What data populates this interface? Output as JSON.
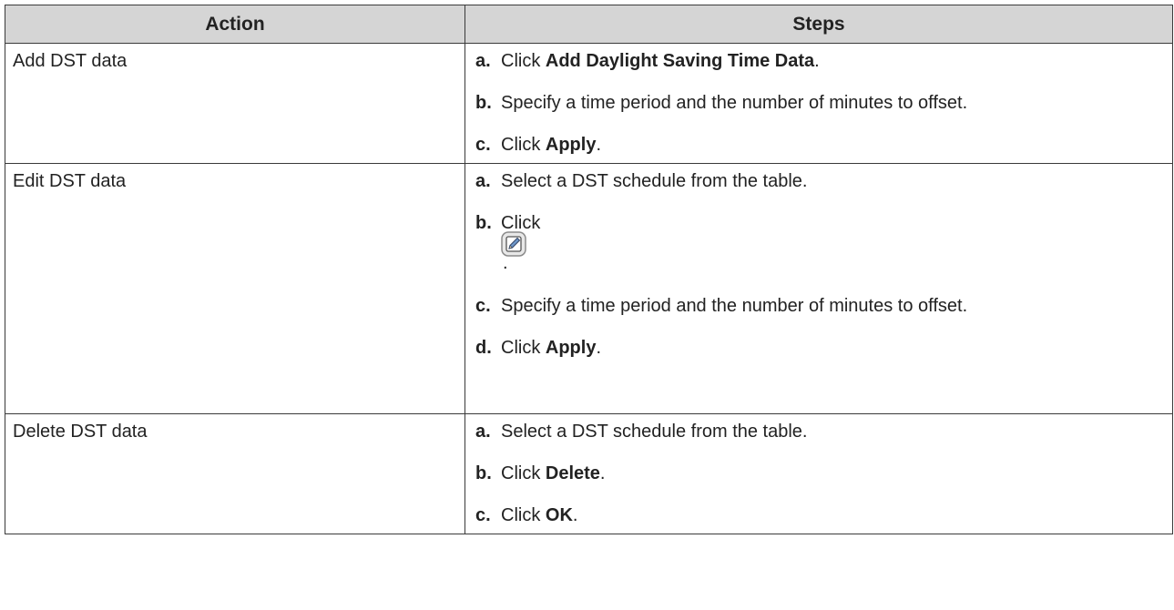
{
  "table": {
    "headers": [
      "Action",
      "Steps"
    ],
    "rows": [
      {
        "action": "Add DST data",
        "steps": [
          {
            "letter": "a.",
            "pre": "Click ",
            "bold": "Add Daylight Saving Time Data",
            "post": "."
          },
          {
            "letter": "b.",
            "pre": "Specify a time period and the number of minutes to offset.",
            "bold": "",
            "post": ""
          },
          {
            "letter": "c.",
            "pre": "Click ",
            "bold": "Apply",
            "post": "."
          }
        ]
      },
      {
        "action": "Edit DST data",
        "steps": [
          {
            "letter": "a.",
            "pre": "Select a DST schedule from the table.",
            "bold": "",
            "post": ""
          },
          {
            "letter": "b.",
            "pre": "Click",
            "bold": "",
            "post": ".",
            "icon": "edit-pencil-icon"
          },
          {
            "letter": "c.",
            "pre": "Specify a time period and the number of minutes to offset.",
            "bold": "",
            "post": ""
          },
          {
            "letter": "d.",
            "pre": "Click ",
            "bold": "Apply",
            "post": "."
          }
        ]
      },
      {
        "action": "Delete DST data",
        "steps": [
          {
            "letter": "a.",
            "pre": "Select a DST schedule from the table.",
            "bold": "",
            "post": ""
          },
          {
            "letter": "b.",
            "pre": "Click ",
            "bold": "Delete",
            "post": "."
          },
          {
            "letter": "c.",
            "pre": "Click ",
            "bold": "OK",
            "post": "."
          }
        ]
      }
    ]
  },
  "colors": {
    "header_bg": "#d5d5d5",
    "border": "#3a3a3a",
    "text": "#222222"
  }
}
